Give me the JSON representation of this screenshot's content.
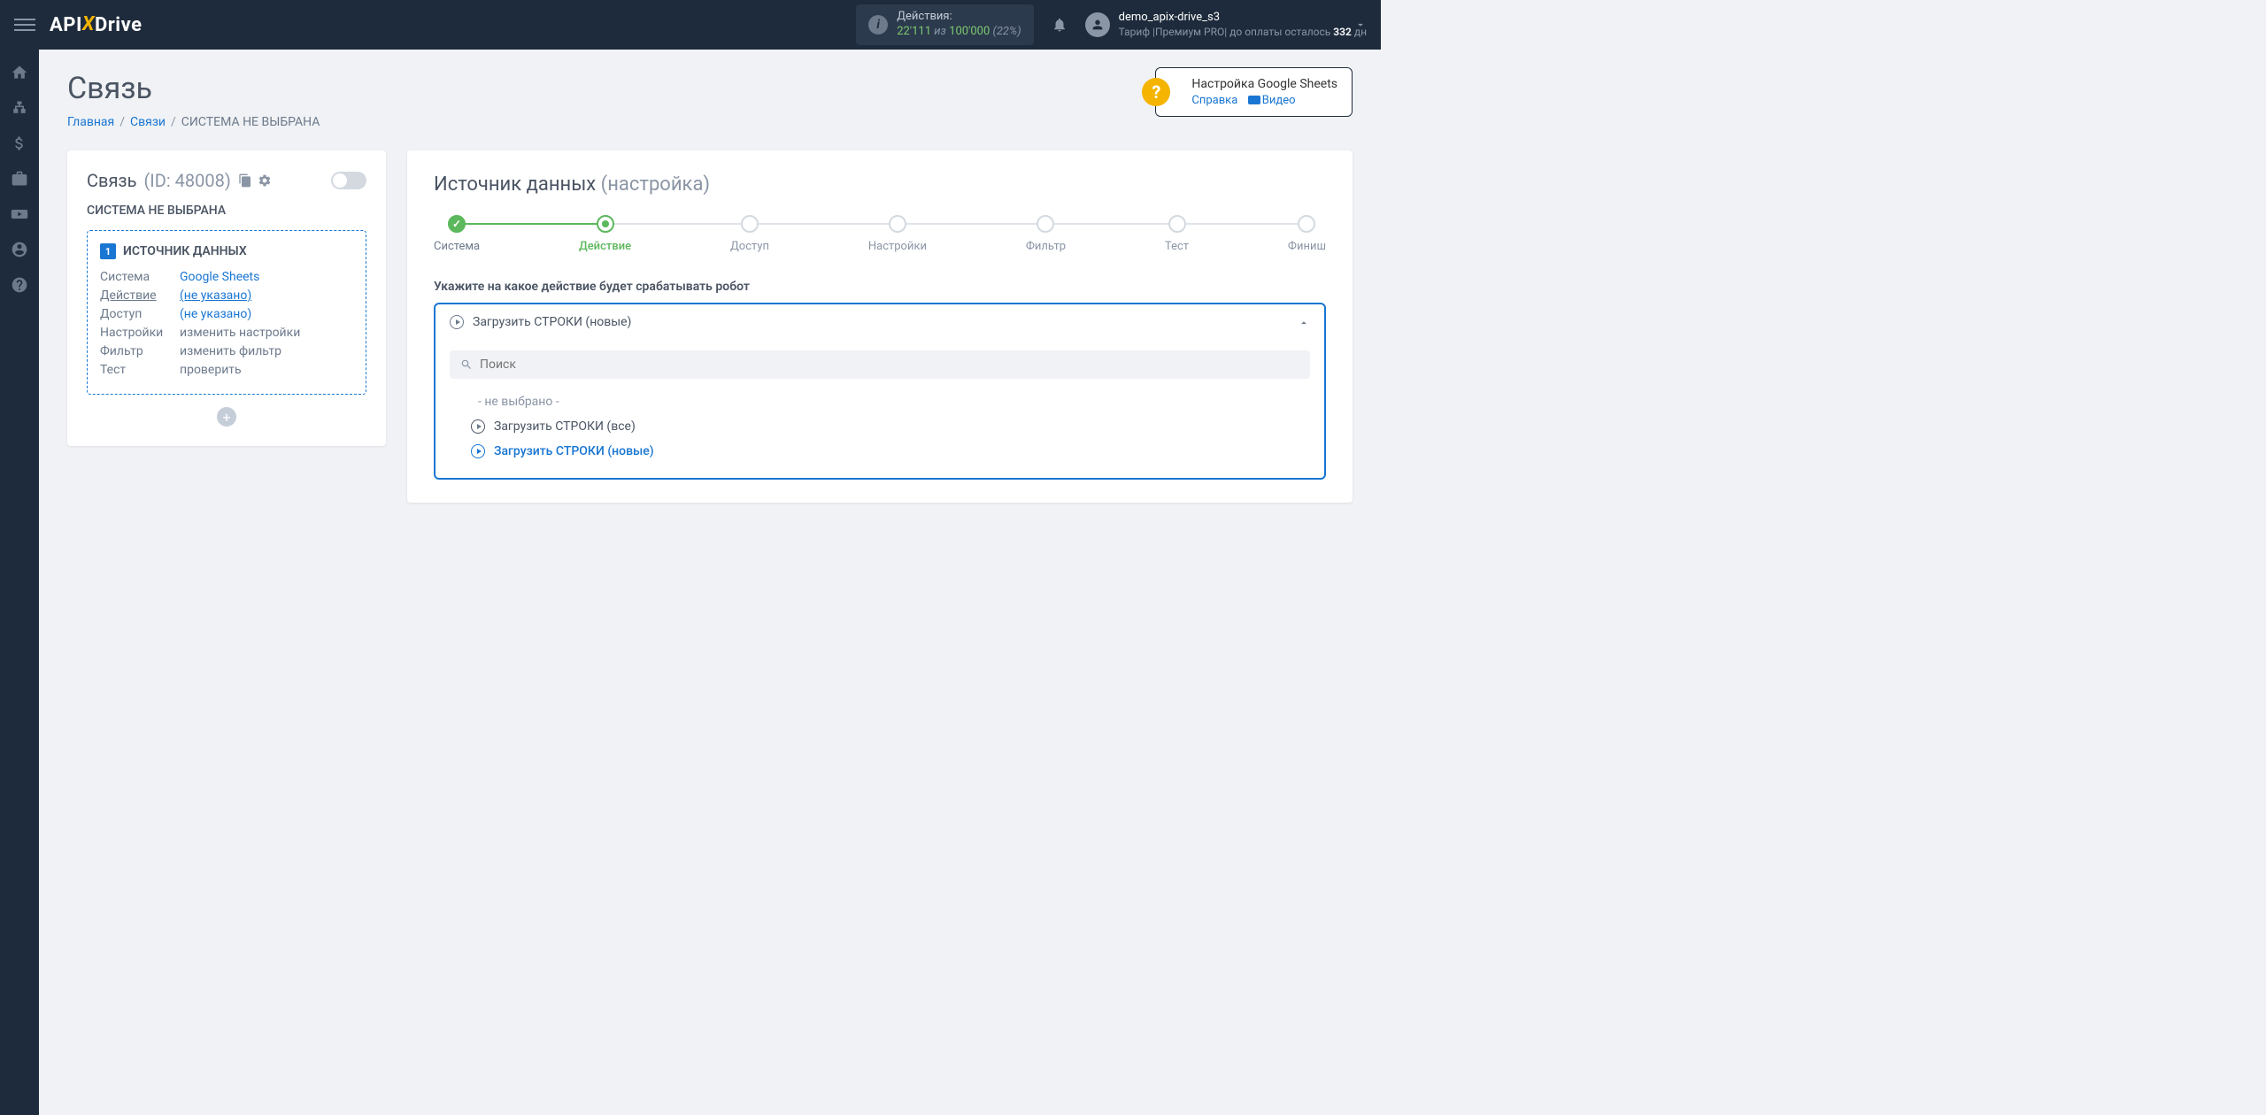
{
  "brand": {
    "pre": "API",
    "x": "X",
    "post": "Drive"
  },
  "header": {
    "actions_label": "Действия:",
    "actions_used": "22'111",
    "actions_sep": "из",
    "actions_total": "100'000",
    "actions_pct": "(22%)",
    "user_name": "demo_apix-drive_s3",
    "tariff_prefix": "Тариф |Премиум PRO| до оплаты осталось ",
    "tariff_days": "332",
    "tariff_suffix": " дн"
  },
  "page": {
    "title": "Связь",
    "breadcrumb": {
      "home": "Главная",
      "links": "Связи",
      "current": "СИСТЕМА НЕ ВЫБРАНА"
    }
  },
  "help": {
    "title": "Настройка Google Sheets",
    "ref": "Справка",
    "video": "Видео"
  },
  "left": {
    "title": "Связь",
    "id": "(ID: 48008)",
    "subtitle": "СИСТЕМА НЕ ВЫБРАНА",
    "source_label": "ИСТОЧНИК ДАННЫХ",
    "rows": {
      "system_k": "Система",
      "system_v": "Google Sheets",
      "action_k": "Действие",
      "action_v": "(не указано)",
      "access_k": "Доступ",
      "access_v": "(не указано)",
      "settings_k": "Настройки",
      "settings_v": "изменить настройки",
      "filter_k": "Фильтр",
      "filter_v": "изменить фильтр",
      "test_k": "Тест",
      "test_v": "проверить"
    }
  },
  "right": {
    "title": "Источник данных",
    "title_sub": "(настройка)",
    "steps": [
      "Система",
      "Действие",
      "Доступ",
      "Настройки",
      "Фильтр",
      "Тест",
      "Финиш"
    ],
    "field_label": "Укажите на какое действие будет срабатывать робот",
    "selected": "Загрузить СТРОКИ (новые)",
    "search_placeholder": "Поиск",
    "opt_none": "- не выбрано -",
    "opt_all": "Загрузить СТРОКИ (все)",
    "opt_new": "Загрузить СТРОКИ (новые)"
  }
}
